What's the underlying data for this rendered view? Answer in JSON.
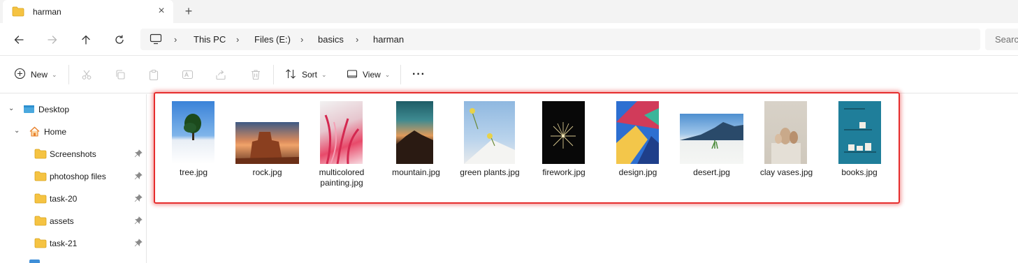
{
  "tab": {
    "title": "harman",
    "close_icon": "×",
    "new_tab_icon": "+"
  },
  "address": {
    "crumbs": [
      "This PC",
      "Files (E:)",
      "basics",
      "harman"
    ],
    "separator": "›",
    "search_placeholder": "Searc"
  },
  "commands": {
    "new_label": "New",
    "sort_label": "Sort",
    "view_label": "View",
    "more_label": "···",
    "dropdown_glyph": "⌄"
  },
  "sidebar": {
    "items": [
      {
        "label": "Desktop",
        "icon": "desktop-icon",
        "expanded": true
      },
      {
        "label": "Home",
        "icon": "home-icon",
        "expanded": true
      },
      {
        "label": "Screenshots",
        "icon": "folder-icon",
        "pinned": true
      },
      {
        "label": "photoshop files",
        "icon": "folder-icon",
        "pinned": true
      },
      {
        "label": "task-20",
        "icon": "folder-icon",
        "pinned": true
      },
      {
        "label": "assets",
        "icon": "folder-icon",
        "pinned": true
      },
      {
        "label": "task-21",
        "icon": "folder-icon",
        "pinned": true
      }
    ],
    "expand_glyph": "⌄"
  },
  "files": [
    {
      "name": "tree.jpg"
    },
    {
      "name": "rock.jpg"
    },
    {
      "name": "multicolored painting.jpg"
    },
    {
      "name": "mountain.jpg"
    },
    {
      "name": "green plants.jpg"
    },
    {
      "name": "firework.jpg"
    },
    {
      "name": "design.jpg"
    },
    {
      "name": "desert.jpg"
    },
    {
      "name": "clay vases.jpg"
    },
    {
      "name": "books.jpg"
    }
  ],
  "colors": {
    "highlight": "#e62d2d",
    "folder": "#f5c342",
    "accent": "#0067c0"
  }
}
